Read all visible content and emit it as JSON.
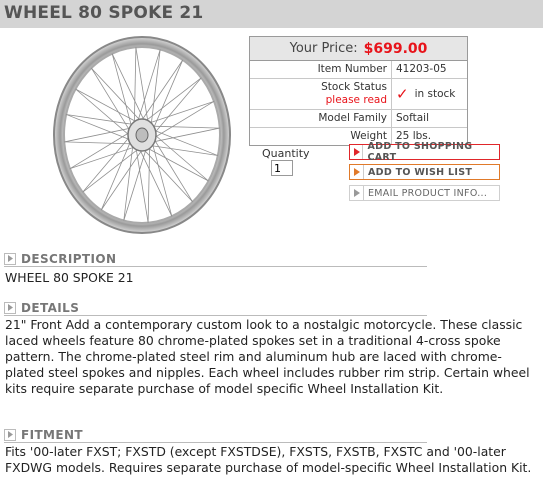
{
  "product": {
    "title": "WHEEL 80 SPOKE 21"
  },
  "price_table": {
    "price_label": "Your Price:",
    "price_value": "$699.00",
    "rows": [
      {
        "key": "Item Number",
        "value": "41203-05"
      },
      {
        "key": "Stock Status",
        "key_sub": "please read",
        "value": "in stock"
      },
      {
        "key": "Model Family",
        "value": "Softail"
      },
      {
        "key": "Weight",
        "value": "25 lbs."
      }
    ]
  },
  "quantity": {
    "label": "Quantity",
    "value": "1"
  },
  "actions": {
    "add_to_cart": "ADD TO SHOPPING CART",
    "add_to_wishlist": "ADD TO WISH LIST",
    "email_info": "EMAIL PRODUCT INFO..."
  },
  "sections": {
    "description": {
      "title": "DESCRIPTION",
      "body": "WHEEL 80 SPOKE 21"
    },
    "details": {
      "title": "DETAILS",
      "body": "21\" Front Add a contemporary custom look to a nostalgic motorcycle. These classic laced wheels feature 80 chrome-plated spokes set in a traditional 4-cross spoke pattern. The chrome-plated steel rim and aluminum hub are laced with chrome-plated steel spokes and nipples. Each wheel includes rubber rim strip. Certain wheel kits require separate purchase of model specific Wheel Installation Kit."
    },
    "fitment": {
      "title": "FITMENT",
      "body": "Fits '00-later FXST; FXSTD (except FXSTDSE), FXSTS, FXSTB, FXSTC and '00-later FXDWG models. Requires separate purchase of model-specific Wheel Installation Kit."
    }
  },
  "colors": {
    "accent_red": "#e8131a",
    "header_bg": "#d4d4d4"
  }
}
